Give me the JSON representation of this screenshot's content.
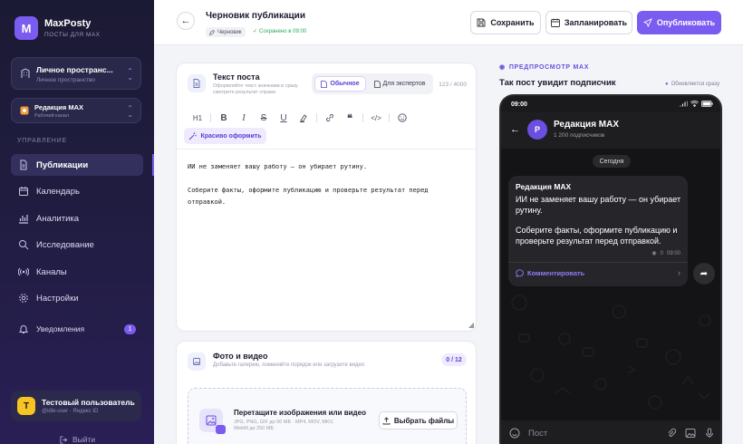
{
  "sidebar": {
    "brand": {
      "logo_letter": "M",
      "name": "MaxPosty",
      "tagline": "ПОСТЫ ДЛЯ MAX"
    },
    "workspace": {
      "title": "Личное пространс...",
      "subtitle": "Личное пространство"
    },
    "channel": {
      "title": "Редакция MAX",
      "subtitle": "Рабочий канал"
    },
    "section_label": "УПРАВЛЕНИЕ",
    "nav": [
      {
        "label": "Публикации",
        "icon": "document-icon",
        "active": true
      },
      {
        "label": "Календарь",
        "icon": "calendar-icon"
      },
      {
        "label": "Аналитика",
        "icon": "chart-icon"
      },
      {
        "label": "Исследование",
        "icon": "search-icon"
      },
      {
        "label": "Каналы",
        "icon": "broadcast-icon"
      },
      {
        "label": "Настройки",
        "icon": "gear-icon"
      }
    ],
    "notifications": {
      "label": "Уведомления",
      "count": "1"
    },
    "user": {
      "initial": "T",
      "name": "Тестовый пользователь",
      "subtitle": "@idle-user · Яндекс ID"
    },
    "logout_label": "Выйти"
  },
  "header": {
    "title": "Черновик публикации",
    "status": "Черновик",
    "saved_note": "Сохранено в 09:00",
    "save_label": "Сохранить",
    "schedule_label": "Запланировать",
    "publish_label": "Опубликовать"
  },
  "editor": {
    "title": "Текст поста",
    "subtitle": "Оформляйте текст значками и сразу смотрите результат справа",
    "mode_normal": "Обычное",
    "mode_expert": "Для экспертов",
    "char_count": "123 / 4000",
    "toolbar_heading": "H1",
    "beautify_label": "Красиво оформить",
    "paragraphs": [
      "ИИ не заменяет вашу работу — он убирает рутину.",
      "Соберите факты, оформите публикацию и проверьте результат перед отправкой."
    ]
  },
  "media": {
    "title": "Фото и видео",
    "subtitle": "Добавьте галерею, поменяйте порядок или загрузите видео",
    "count": "0 / 12",
    "drop_title": "Перетащите изображения или видео",
    "drop_hint": "JPG, PNG, GIF до 50 МБ · MP4, MOV, MKV, WebM до 250 МБ",
    "choose_label": "Выбрать файлы"
  },
  "preview": {
    "label": "ПРЕДПРОСМОТР MAX",
    "title": "Так пост увидит подписчик",
    "live_note": "Обновляется сразу",
    "phone_time": "09:00",
    "channel_initial": "P",
    "channel_name": "Редакция MAX",
    "subscribers": "1 200 подписчиков",
    "day_label": "Сегодня",
    "post_author": "Редакция MAX",
    "post_paragraphs": [
      "ИИ не заменяет вашу работу — он убирает рутину.",
      "Соберите факты, оформите публикацию и проверьте результат перед отправкой."
    ],
    "views": "0",
    "post_time": "09:00",
    "comment_label": "Комментировать",
    "input_placeholder": "Пост"
  },
  "colors": {
    "accent": "#7b5cf0",
    "sidebar_bg": "#1b1a33",
    "success": "#2ea85a"
  }
}
